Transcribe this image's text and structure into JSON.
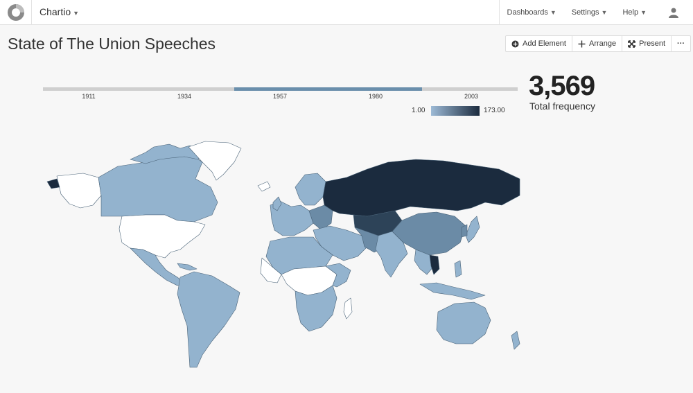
{
  "app": {
    "name": "Chartio"
  },
  "nav": {
    "dashboards": "Dashboards",
    "settings": "Settings",
    "help": "Help"
  },
  "page": {
    "title": "State of The Union Speeches"
  },
  "toolbar": {
    "add_element": "Add Element",
    "arrange": "Arrange",
    "present": "Present",
    "more": "···"
  },
  "timeline": {
    "ticks": [
      "1911",
      "1934",
      "1957",
      "1980",
      "2003"
    ],
    "selected_range": [
      "1946",
      "1986"
    ]
  },
  "legend": {
    "min": "1.00",
    "max": "173.00",
    "color_low": "#9dbad6",
    "color_high": "#1b2b3e"
  },
  "kpi": {
    "value": "3,569",
    "label": "Total frequency"
  },
  "colors": {
    "accent": "#6a8fac",
    "light": "#93b3ce",
    "mid": "#6b8ba6",
    "dark": "#1b2b3e",
    "empty": "#ffffff"
  }
}
